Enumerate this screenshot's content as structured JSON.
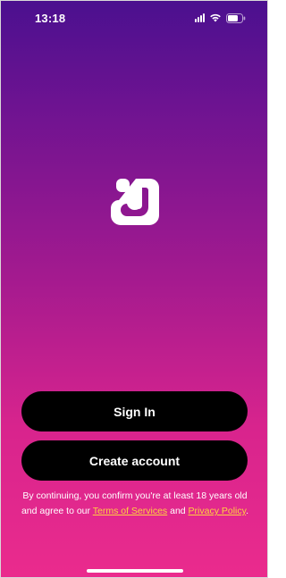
{
  "status_bar": {
    "time": "13:18",
    "icons": [
      "signal-icon",
      "wifi-icon",
      "battery-icon"
    ]
  },
  "logo": {
    "icon": "app-logo-icon",
    "color": "#ffffff"
  },
  "buttons": {
    "sign_in": "Sign In",
    "create_account": "Create account"
  },
  "legal": {
    "prefix": "By continuing, you confirm you're at least 18 years old and agree to our ",
    "terms_link": "Terms of Services",
    "middle": " and ",
    "privacy_link": "Privacy Policy",
    "suffix": "."
  },
  "colors": {
    "gradient_top": "#4b108f",
    "gradient_bottom": "#ea2b8d",
    "button_bg": "#000000",
    "link": "#ffd23f"
  }
}
